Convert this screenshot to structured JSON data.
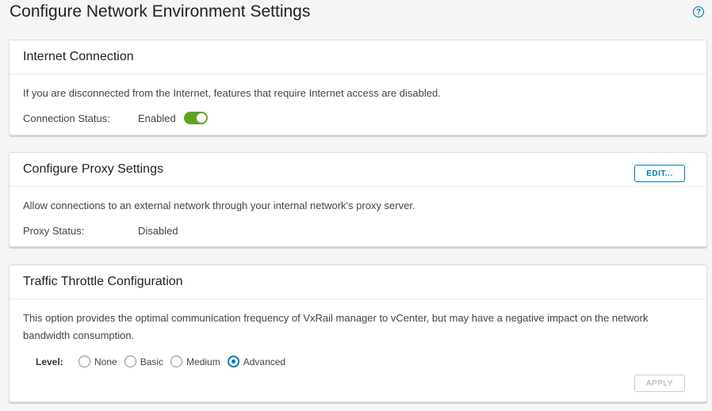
{
  "page": {
    "title": "Configure Network Environment Settings",
    "help_glyph": "?"
  },
  "internet": {
    "title": "Internet Connection",
    "description": "If you are disconnected from the Internet, features that require Internet access are disabled.",
    "status_label": "Connection Status:",
    "status_value": "Enabled",
    "toggle_on": true,
    "toggle_color": "#62a420"
  },
  "proxy": {
    "title": "Configure Proxy Settings",
    "edit_label": "EDIT...",
    "description": "Allow connections to an external network through your internal network's proxy server.",
    "status_label": "Proxy Status:",
    "status_value": "Disabled"
  },
  "throttle": {
    "title": "Traffic Throttle Configuration",
    "description": "This option provides the optimal communication frequency of VxRail manager to vCenter, but may have a negative impact on the network bandwidth consumption.",
    "level_label": "Level:",
    "options": [
      "None",
      "Basic",
      "Medium",
      "Advanced"
    ],
    "selected": "Advanced",
    "apply_label": "APPLY"
  },
  "colors": {
    "accent": "#0079b8",
    "help": "#0072a3"
  }
}
